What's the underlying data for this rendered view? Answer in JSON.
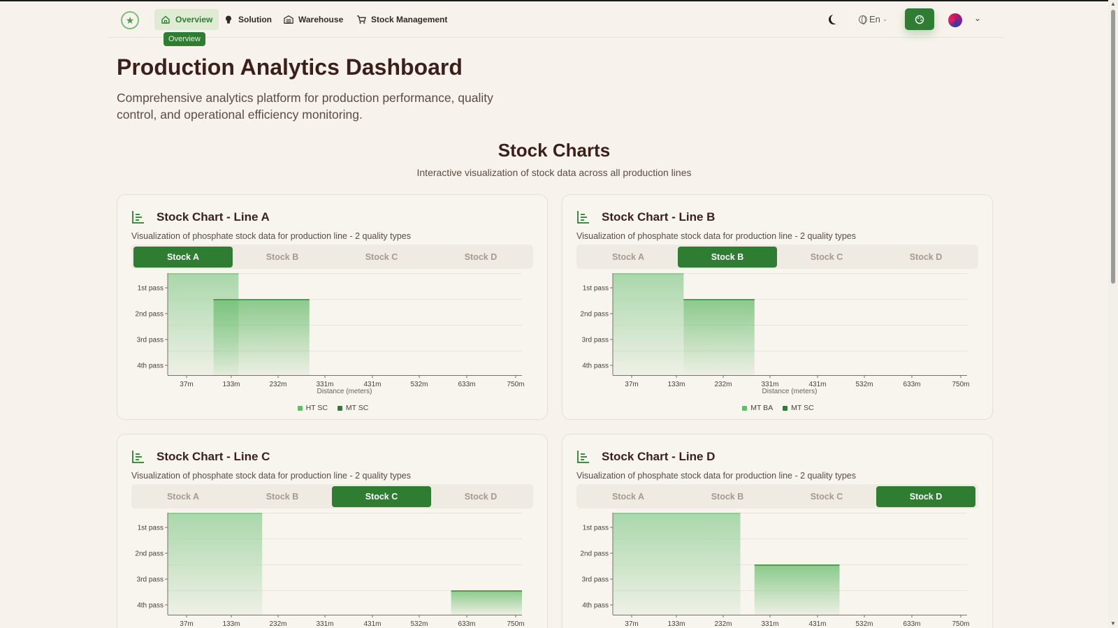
{
  "nav": {
    "items": [
      {
        "label": "Overview",
        "icon": "home-icon",
        "active": true
      },
      {
        "label": "Solution",
        "icon": "lightbulb-icon",
        "active": false
      },
      {
        "label": "Warehouse",
        "icon": "warehouse-icon",
        "active": false
      },
      {
        "label": "Stock Management",
        "icon": "cart-icon",
        "active": false
      }
    ],
    "tooltip": "Overview",
    "language": "En"
  },
  "header": {
    "title": "Production Analytics Dashboard",
    "description": "Comprehensive analytics platform for production performance, quality control, and operational efficiency monitoring."
  },
  "section": {
    "title": "Stock Charts",
    "subtitle": "Interactive visualization of stock data across all production lines"
  },
  "colors": {
    "accent": "#2e7d32",
    "bar_light": "#a5d6a7",
    "bar_dark": "#66bb6a",
    "legend_light": "#5fbf68",
    "legend_dark": "#2e7d32"
  },
  "tab_labels": [
    "Stock A",
    "Stock B",
    "Stock C",
    "Stock D"
  ],
  "cards": [
    {
      "title": "Stock Chart - Line A",
      "desc": "Visualization of phosphate stock data for production line - 2 quality types",
      "active_tab": 0
    },
    {
      "title": "Stock Chart - Line B",
      "desc": "Visualization of phosphate stock data for production line - 2 quality types",
      "active_tab": 1
    },
    {
      "title": "Stock Chart - Line C",
      "desc": "Visualization of phosphate stock data for production line - 2 quality types",
      "active_tab": 2
    },
    {
      "title": "Stock Chart - Line D",
      "desc": "Visualization of phosphate stock data for production line - 2 quality types",
      "active_tab": 3
    }
  ],
  "chart_data": [
    {
      "type": "bar",
      "title": "Stock Chart - Line A",
      "xlabel": "Distance (meters)",
      "x_ticks": [
        "37m",
        "133m",
        "232m",
        "331m",
        "431m",
        "532m",
        "633m",
        "750m"
      ],
      "x_range": [
        0,
        750
      ],
      "y_categories": [
        "1st pass",
        "2nd pass",
        "3rd pass",
        "4th pass"
      ],
      "series": [
        {
          "name": "HT SC",
          "bars": [
            {
              "x_start": 0,
              "x_end": 150,
              "level": "1st pass"
            }
          ]
        },
        {
          "name": "MT SC",
          "bars": [
            {
              "x_start": 97,
              "x_end": 300,
              "level": "2nd pass"
            }
          ]
        }
      ]
    },
    {
      "type": "bar",
      "title": "Stock Chart - Line B",
      "xlabel": "Distance (meters)",
      "x_ticks": [
        "37m",
        "133m",
        "232m",
        "331m",
        "431m",
        "532m",
        "633m",
        "750m"
      ],
      "x_range": [
        0,
        750
      ],
      "y_categories": [
        "1st pass",
        "2nd pass",
        "3rd pass",
        "4th pass"
      ],
      "series": [
        {
          "name": "MT BA",
          "bars": [
            {
              "x_start": 0,
              "x_end": 150,
              "level": "1st pass"
            }
          ]
        },
        {
          "name": "MT SC",
          "bars": [
            {
              "x_start": 150,
              "x_end": 300,
              "level": "2nd pass"
            }
          ]
        }
      ]
    },
    {
      "type": "bar",
      "title": "Stock Chart - Line C",
      "x_ticks": [
        "37m",
        "133m",
        "232m",
        "331m",
        "431m",
        "532m",
        "633m",
        "750m"
      ],
      "x_range": [
        0,
        750
      ],
      "y_categories": [
        "1st pass",
        "2nd pass",
        "3rd pass",
        "4th pass"
      ],
      "series": [
        {
          "bars": [
            {
              "x_start": 0,
              "x_end": 200,
              "level": "1st pass"
            }
          ]
        },
        {
          "bars": [
            {
              "x_start": 600,
              "x_end": 750,
              "level": "4th pass"
            }
          ]
        }
      ]
    },
    {
      "type": "bar",
      "title": "Stock Chart - Line D",
      "x_ticks": [
        "37m",
        "133m",
        "232m",
        "331m",
        "431m",
        "532m",
        "633m",
        "750m"
      ],
      "x_range": [
        0,
        750
      ],
      "y_categories": [
        "1st pass",
        "2nd pass",
        "3rd pass",
        "4th pass"
      ],
      "series": [
        {
          "bars": [
            {
              "x_start": 0,
              "x_end": 270,
              "level": "1st pass"
            }
          ]
        },
        {
          "bars": [
            {
              "x_start": 300,
              "x_end": 480,
              "level": "3rd pass"
            }
          ]
        }
      ]
    }
  ]
}
